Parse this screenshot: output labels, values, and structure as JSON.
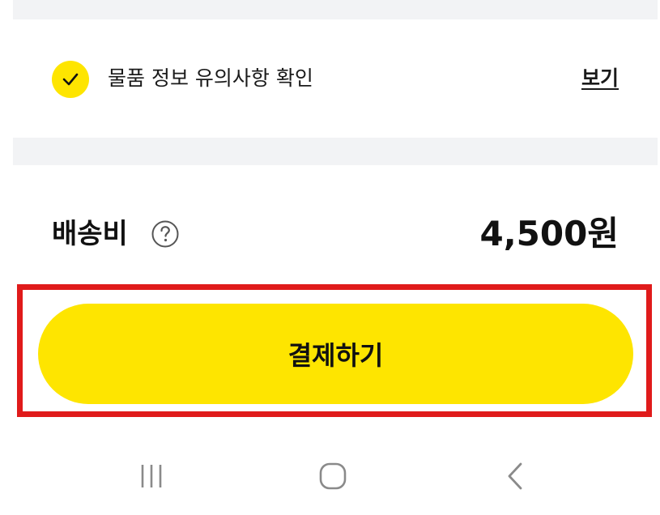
{
  "notice": {
    "label": "물품 정보 유의사항 확인",
    "checked": true,
    "view_link": "보기"
  },
  "shipping": {
    "label": "배송비",
    "help_icon": "question-circle-icon",
    "value": "4,500원"
  },
  "actions": {
    "pay_label": "결제하기"
  },
  "system_nav": {
    "recents_icon": "recents-icon",
    "home_icon": "home-icon",
    "back_icon": "back-icon"
  },
  "colors": {
    "accent": "#fee500",
    "highlight": "#e01b1b",
    "divider": "#f2f3f5",
    "text": "#111111"
  }
}
